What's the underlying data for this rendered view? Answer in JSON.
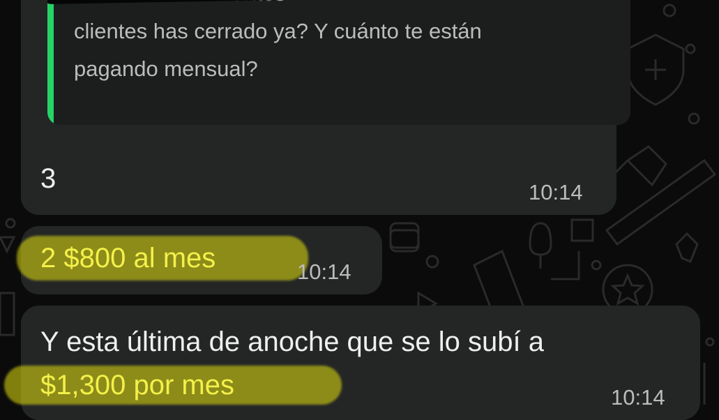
{
  "chat": {
    "quoted": {
      "text": "ada  entonces cuántos\nclientes has cerrado ya? Y cuánto te están\npagando mensual?",
      "accent_color": "#25d366"
    },
    "messages": [
      {
        "text": "3",
        "time": "10:14"
      },
      {
        "text": "2 $800 al mes",
        "time": "10:14"
      },
      {
        "text_line1": "Y esta última de anoche que se lo subí a",
        "text_line2": "$1,300 por mes",
        "time": "10:14"
      }
    ],
    "highlight_color": "#e3e10f"
  }
}
